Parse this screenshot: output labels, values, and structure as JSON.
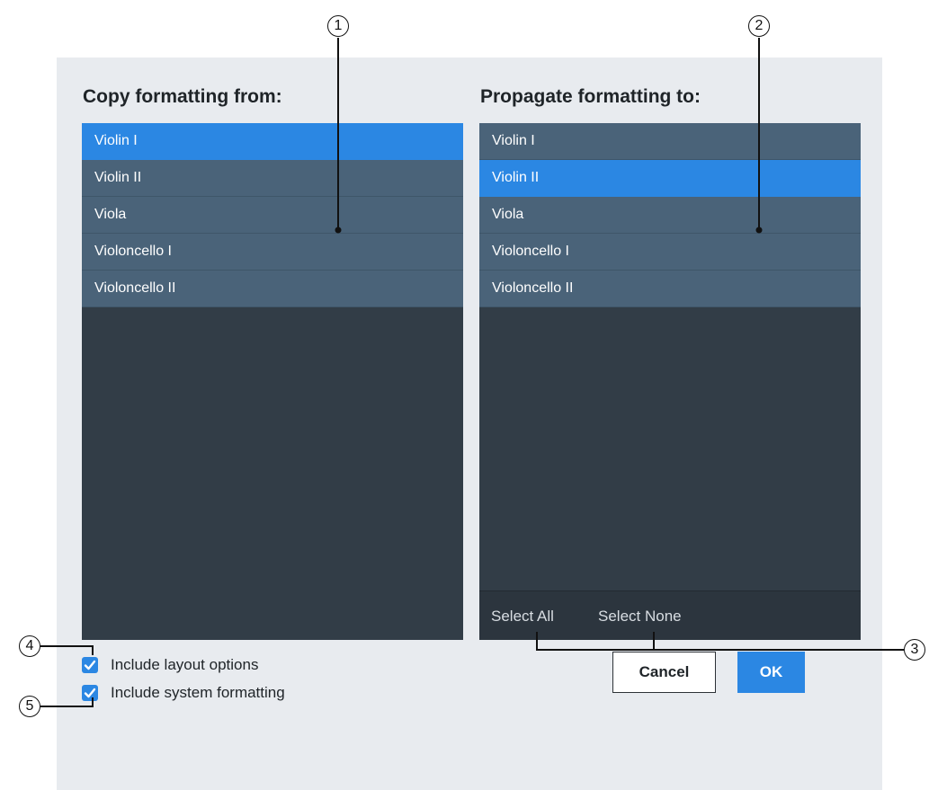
{
  "source_list": {
    "heading": "Copy formatting from:",
    "items": [
      {
        "label": "Violin I",
        "selected": true
      },
      {
        "label": "Violin II",
        "selected": false
      },
      {
        "label": "Viola",
        "selected": false
      },
      {
        "label": "Violoncello I",
        "selected": false
      },
      {
        "label": "Violoncello II",
        "selected": false
      }
    ]
  },
  "target_list": {
    "heading": "Propagate formatting to:",
    "items": [
      {
        "label": "Violin I",
        "selected": false
      },
      {
        "label": "Violin II",
        "selected": true
      },
      {
        "label": "Viola",
        "selected": false
      },
      {
        "label": "Violoncello I",
        "selected": false
      },
      {
        "label": "Violoncello II",
        "selected": false
      }
    ],
    "select_all_label": "Select All",
    "select_none_label": "Select None"
  },
  "options": {
    "include_layout_options": {
      "label": "Include layout options",
      "checked": true
    },
    "include_system_formatting": {
      "label": "Include system formatting",
      "checked": true
    }
  },
  "buttons": {
    "cancel_label": "Cancel",
    "ok_label": "OK"
  },
  "callouts": [
    "1",
    "2",
    "3",
    "4",
    "5"
  ],
  "colors": {
    "accent": "#2b87e3",
    "list_item": "#4a6379",
    "list_background": "#323d47",
    "dialog_background": "#e8ebef"
  }
}
